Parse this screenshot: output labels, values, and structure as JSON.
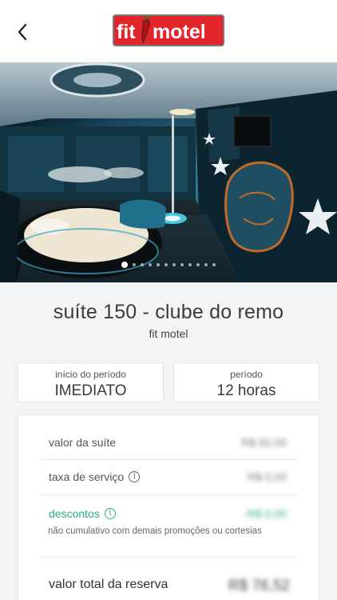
{
  "header": {
    "logo_text_left": "fit",
    "logo_text_right": "motel"
  },
  "photo": {
    "slide_count": 12,
    "active_index": 0
  },
  "suite": {
    "title": "suíte 150 - clube do remo",
    "motel_name": "fit motel"
  },
  "period": {
    "start_label": "início do período",
    "start_value": "IMEDIATO",
    "duration_label": "período",
    "duration_value": "12 horas"
  },
  "summary": {
    "suite_value_label": "valor da suíte",
    "suite_value_amount": "R$ 82,00",
    "service_fee_label": "taxa de serviço",
    "service_fee_amount": "R$ 0,00",
    "discounts_label": "descontos",
    "discounts_amount": "-R$ 0,00",
    "discounts_note": "não cumulativo com demais promoções ou cortesias",
    "total_label": "valor total da reserva",
    "total_amount": "R$ 76,52"
  },
  "colors": {
    "accent_green": "#2fae7a",
    "logo_red": "#e2242b"
  }
}
